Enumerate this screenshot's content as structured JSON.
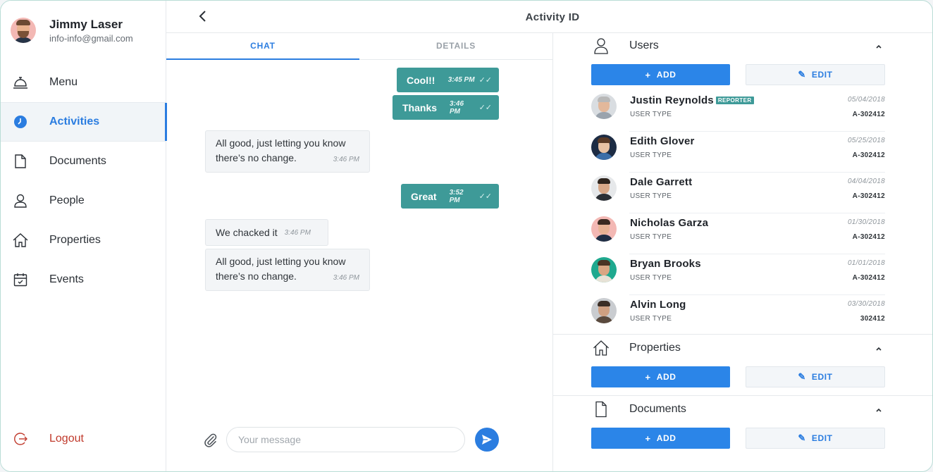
{
  "profile": {
    "name": "Jimmy Laser",
    "email": "info-info@gmail.com"
  },
  "nav": [
    {
      "label": "Menu",
      "icon": "bell-icon",
      "active": false
    },
    {
      "label": "Activities",
      "icon": "clock-icon",
      "active": true
    },
    {
      "label": "Documents",
      "icon": "document-icon",
      "active": false
    },
    {
      "label": "People",
      "icon": "person-icon",
      "active": false
    },
    {
      "label": "Properties",
      "icon": "home-icon",
      "active": false
    },
    {
      "label": "Events",
      "icon": "calendar-icon",
      "active": false
    }
  ],
  "logout_label": "Logout",
  "header": {
    "title": "Activity ID"
  },
  "tabs": {
    "chat": "CHAT",
    "details": "DETAILS"
  },
  "messages": [
    {
      "dir": "out",
      "text": "Cool!!",
      "time": "3:45 PM"
    },
    {
      "dir": "out",
      "text": "Thanks",
      "time": "3:46 PM"
    },
    {
      "dir": "in",
      "line1": "All good, just letting you know",
      "line2": "there’s no change.",
      "time": "3:46 PM"
    },
    {
      "dir": "out",
      "text": "Great",
      "time": "3:52 PM"
    },
    {
      "dir": "in",
      "line1": "We chacked it",
      "time": "3:46 PM"
    },
    {
      "dir": "in",
      "line1": "All good, just letting you know",
      "line2": "there’s no change.",
      "time": "3:46 PM"
    }
  ],
  "composer": {
    "placeholder": "Your message"
  },
  "sections": {
    "users": {
      "title": "Users",
      "add": "ADD",
      "edit": "EDIT"
    },
    "properties": {
      "title": "Properties",
      "add": "ADD",
      "edit": "EDIT"
    },
    "documents": {
      "title": "Documents",
      "add": "ADD",
      "edit": "EDIT"
    }
  },
  "users": [
    {
      "name": "Justin Reynolds",
      "badge": "REPORTER",
      "type": "USER TYPE",
      "date": "05/04/2018",
      "code": "A-302412"
    },
    {
      "name": "Edith Glover",
      "type": "USER TYPE",
      "date": "05/25/2018",
      "code": "A-302412"
    },
    {
      "name": "Dale Garrett",
      "type": "USER TYPE",
      "date": "04/04/2018",
      "code": "A-302412"
    },
    {
      "name": "Nicholas Garza",
      "type": "USER TYPE",
      "date": "01/30/2018",
      "code": "A-302412"
    },
    {
      "name": "Bryan Brooks",
      "type": "USER TYPE",
      "date": "01/01/2018",
      "code": "A-302412"
    },
    {
      "name": "Alvin Long",
      "type": "USER TYPE",
      "date": "03/30/2018",
      "code": "302412"
    }
  ],
  "colors": {
    "accent": "#2b7de0",
    "teal": "#3e9a98",
    "logout": "#c0392b"
  }
}
